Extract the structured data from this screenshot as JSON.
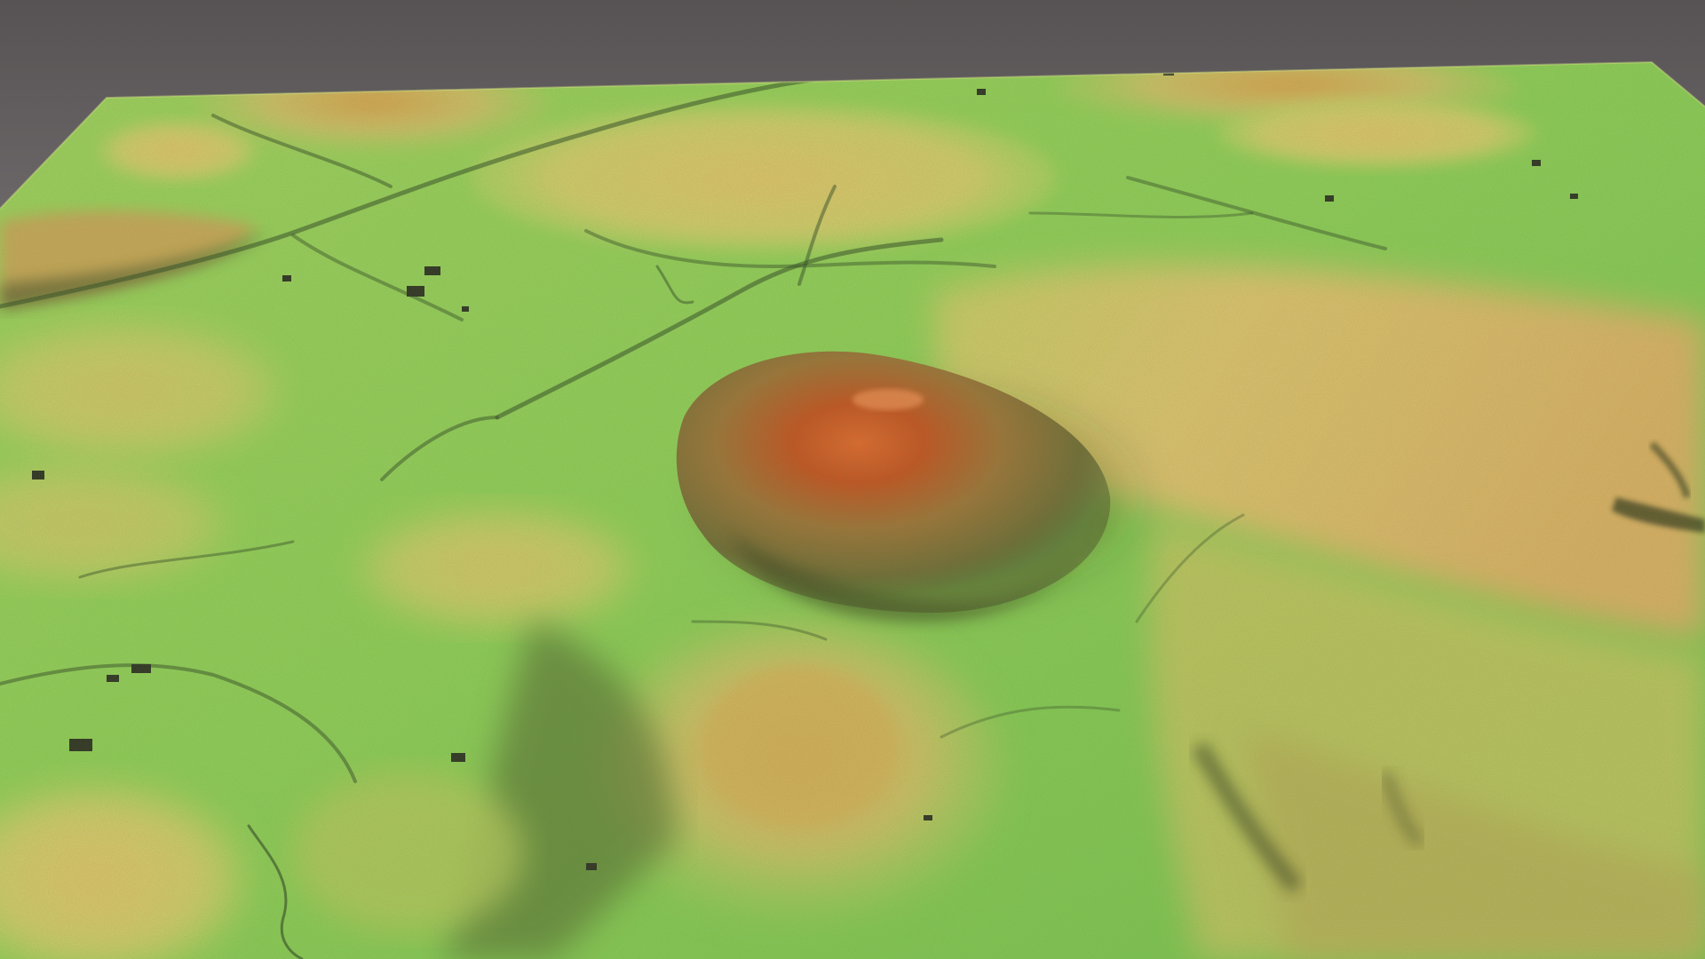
{
  "scene": {
    "subject": "terrain-model",
    "palette": {
      "low": "#6fc94f",
      "low_mid": "#a8d45a",
      "mid": "#d9c866",
      "high": "#c89a4a",
      "peak": "#c5501e",
      "shadow": "#2d3a1f",
      "background_top": "#5e5a5b",
      "background_bottom": "#b3afb0"
    }
  }
}
